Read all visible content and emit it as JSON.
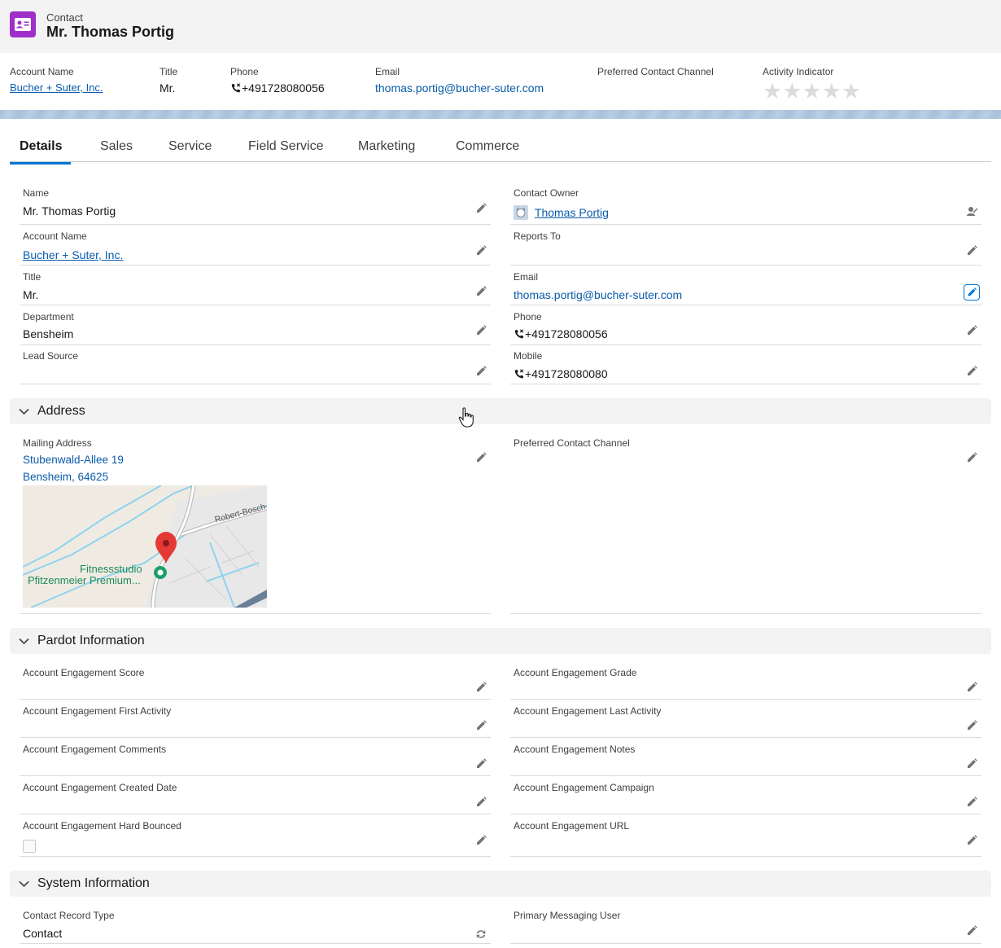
{
  "header": {
    "object_label": "Contact",
    "title": "Mr. Thomas Portig"
  },
  "highlights": {
    "account_name_label": "Account Name",
    "account_name": "Bucher + Suter, Inc.",
    "title_label": "Title",
    "title": "Mr.",
    "phone_label": "Phone",
    "phone": "+491728080056",
    "email_label": "Email",
    "email": "thomas.portig@bucher-suter.com",
    "pref_channel_label": "Preferred Contact Channel",
    "activity_label": "Activity Indicator",
    "activity_stars_filled": 0,
    "activity_stars_total": 5
  },
  "tabs": [
    "Details",
    "Sales",
    "Service",
    "Field Service",
    "Marketing",
    "Commerce"
  ],
  "details": {
    "name_label": "Name",
    "name": "Mr. Thomas Portig",
    "account_label": "Account Name",
    "account": "Bucher + Suter, Inc.",
    "title_label": "Title",
    "title": "Mr.",
    "department_label": "Department",
    "department": "Bensheim",
    "lead_source_label": "Lead Source",
    "owner_label": "Contact Owner",
    "owner": "Thomas Portig",
    "reports_to_label": "Reports To",
    "email_label": "Email",
    "email": "thomas.portig@bucher-suter.com",
    "phone_label": "Phone",
    "phone": "+491728080056",
    "mobile_label": "Mobile",
    "mobile": "+491728080080"
  },
  "address": {
    "section_title": "Address",
    "mailing_label": "Mailing Address",
    "street": "Stubenwald-Allee 19",
    "city_line": "Bensheim, 64625",
    "pref_channel_label": "Preferred Contact Channel",
    "map": {
      "road_label": "Robert-Bosch-",
      "poi_line1": "Fitnessstudio",
      "poi_line2": "Pfitzenmeier Premium..."
    }
  },
  "pardot": {
    "section_title": "Pardot Information",
    "fields": {
      "score": "Account Engagement Score",
      "grade": "Account Engagement Grade",
      "first_activity": "Account Engagement First Activity",
      "last_activity": "Account Engagement Last Activity",
      "comments": "Account Engagement Comments",
      "notes": "Account Engagement Notes",
      "created_date": "Account Engagement Created Date",
      "campaign": "Account Engagement Campaign",
      "hard_bounced": "Account Engagement Hard Bounced",
      "url": "Account Engagement URL"
    }
  },
  "system": {
    "section_title": "System Information",
    "record_type_label": "Contact Record Type",
    "record_type": "Contact",
    "messaging_user_label": "Primary Messaging User"
  },
  "colors": {
    "brand": "#a02fc9",
    "link": "#0b5cab",
    "accent": "#0176d3"
  },
  "icons": {
    "record": "contact-card-icon",
    "edit": "pencil-icon",
    "phone": "phone-icon",
    "section_toggle": "chevron-down-icon"
  }
}
